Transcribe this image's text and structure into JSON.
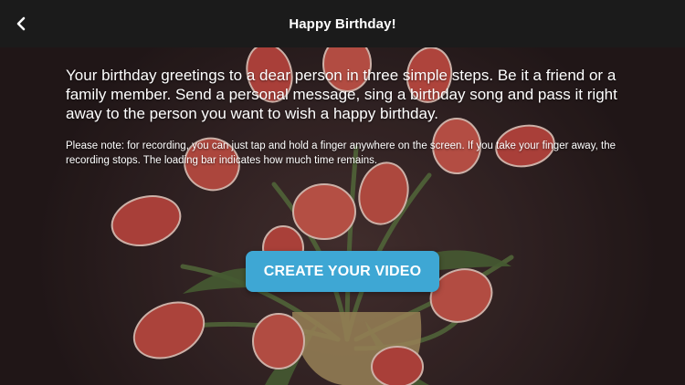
{
  "navbar": {
    "title": "Happy Birthday!",
    "back_icon": "chevron-left-icon"
  },
  "content": {
    "intro": "Your birthday greetings to a dear person in three simple steps. Be it a friend or a family member. Send a personal message, sing a birthday song and pass it right away to the person you want to wish a happy birthday.",
    "note": "Please note: for recording, you can just tap and hold a finger anywhere on the screen. If you take your finger away, the recording stops. The loading bar indicates how much time remains."
  },
  "cta": {
    "label": "CREATE YOUR VIDEO"
  },
  "colors": {
    "navbar_bg": "#1b1b1b",
    "accent_button": "#3ea7d4",
    "text": "#ffffff",
    "tulip": "#d9564c"
  }
}
